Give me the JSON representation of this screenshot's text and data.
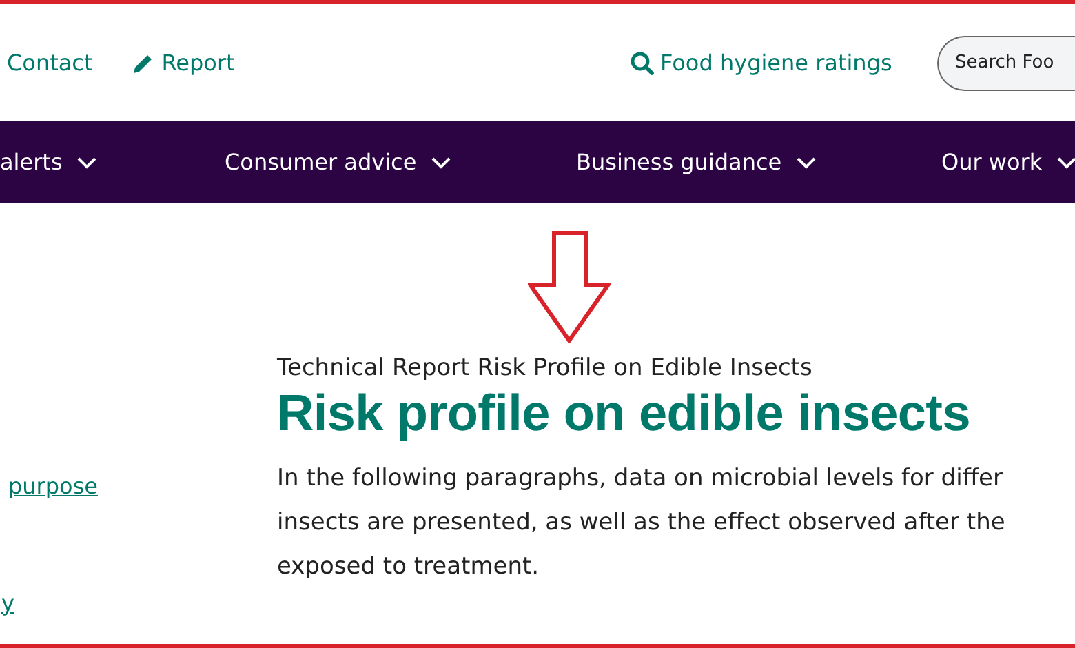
{
  "utility_links": [
    {
      "label": "Contact"
    },
    {
      "label": "Report"
    }
  ],
  "hygiene_link": {
    "label": "Food hygiene ratings"
  },
  "search": {
    "placeholder": "Search Foo"
  },
  "nav": [
    {
      "label": "alerts"
    },
    {
      "label": "Consumer advice"
    },
    {
      "label": "Business guidance"
    },
    {
      "label": "Our work"
    }
  ],
  "sidebar_links": [
    "purpose",
    "y"
  ],
  "content": {
    "subtitle": "Technical Report Risk Profile on Edible Insects",
    "heading": "Risk profile on edible insects",
    "paragraph_lines": [
      "In the following paragraphs, data on microbial levels for differ",
      "insects are presented, as well as the effect observed after the",
      "exposed to treatment."
    ]
  }
}
